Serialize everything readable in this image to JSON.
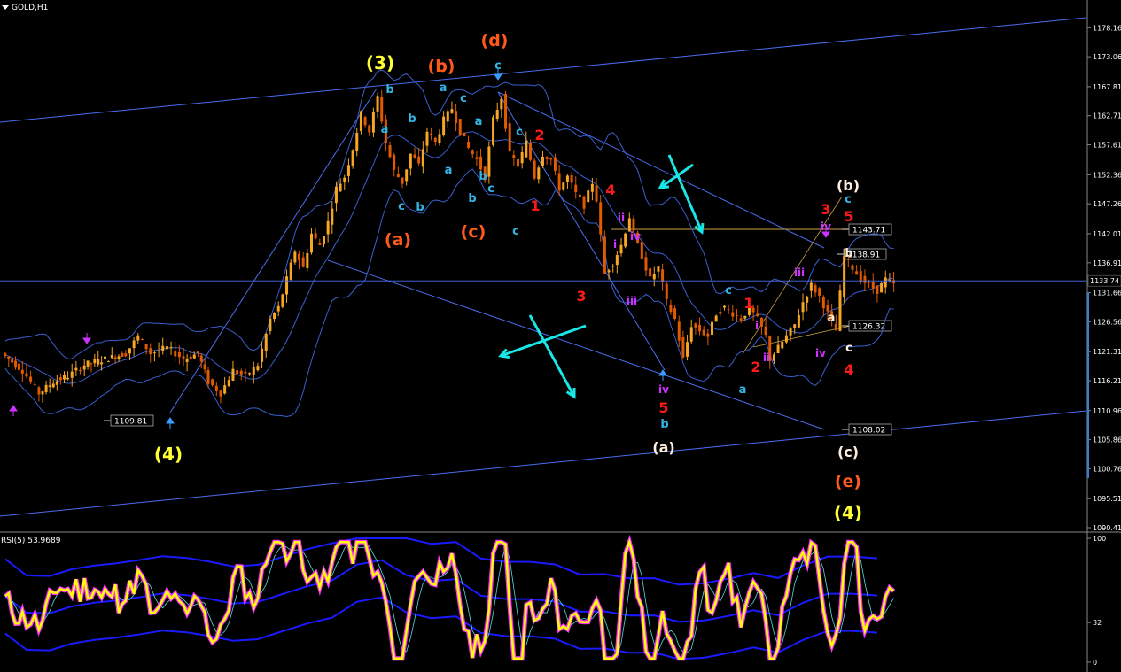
{
  "window": {
    "title": "GOLD,H1"
  },
  "rsi_panel": {
    "title": "RSI(5) 53.9689"
  },
  "colors": {
    "background": "#000000",
    "bull_candle": "#f5a623",
    "bear_candle": "#e05a00",
    "bollinger": "#3a5fcf",
    "channel": "#4a6df0",
    "wave_yellow": "#ffff33",
    "wave_orange": "#ff5a1a",
    "wave_cyan": "#33b5e5",
    "wave_red": "#ff1a1a",
    "wave_magenta": "#cc33ff",
    "wave_white": "#ffeedd",
    "cyan_arrows": "#19e6e6",
    "rsi_main": "#ffff00",
    "rsi_extreme": "#ff33ff",
    "rsi_bands": "#1a1aff"
  },
  "chart_data": [
    {
      "type": "candlestick",
      "title": "GOLD,H1",
      "ylim": [
        1090.41,
        1180.85
      ],
      "y_ticks": [
        "1178.16",
        "1173.06",
        "1167.81",
        "1162.71",
        "1157.61",
        "1152.36",
        "1147.26",
        "1142.01",
        "1136.91",
        "1131.66",
        "1126.56",
        "1121.31",
        "1116.21",
        "1110.96",
        "1105.86",
        "1100.76",
        "1095.51",
        "1090.41"
      ],
      "current_price": "1133.74",
      "price_boxes": [
        "1143.71",
        "1138.91",
        "1126.32",
        "1108.02",
        "1109.81"
      ],
      "close_path": [
        [
          0,
          1121
        ],
        [
          10,
          1118
        ],
        [
          18,
          1114
        ],
        [
          25,
          1116
        ],
        [
          32,
          1117
        ],
        [
          40,
          1119
        ],
        [
          50,
          1120
        ],
        [
          60,
          1121
        ],
        [
          66,
          1124
        ],
        [
          72,
          1121
        ],
        [
          80,
          1122
        ],
        [
          88,
          1120
        ],
        [
          95,
          1121
        ],
        [
          100,
          1116
        ],
        [
          106,
          1114
        ],
        [
          112,
          1118
        ],
        [
          118,
          1117
        ],
        [
          124,
          1119
        ],
        [
          130,
          1127
        ],
        [
          134,
          1129
        ],
        [
          138,
          1134
        ],
        [
          142,
          1139
        ],
        [
          146,
          1136
        ],
        [
          150,
          1142
        ],
        [
          154,
          1140
        ],
        [
          158,
          1144
        ],
        [
          162,
          1150
        ],
        [
          166,
          1152
        ],
        [
          170,
          1157
        ],
        [
          174,
          1163
        ],
        [
          178,
          1160
        ],
        [
          182,
          1166
        ],
        [
          186,
          1158
        ],
        [
          190,
          1153
        ],
        [
          194,
          1151
        ],
        [
          198,
          1156
        ],
        [
          202,
          1154
        ],
        [
          206,
          1160
        ],
        [
          210,
          1158
        ],
        [
          214,
          1162
        ],
        [
          218,
          1164
        ],
        [
          222,
          1160
        ],
        [
          226,
          1157
        ],
        [
          230,
          1155
        ],
        [
          234,
          1152
        ],
        [
          238,
          1162
        ],
        [
          242,
          1166
        ],
        [
          246,
          1156
        ],
        [
          250,
          1154
        ],
        [
          254,
          1158
        ],
        [
          258,
          1152
        ],
        [
          262,
          1156
        ],
        [
          266,
          1155
        ],
        [
          270,
          1150
        ],
        [
          274,
          1152
        ],
        [
          278,
          1149
        ],
        [
          282,
          1147
        ],
        [
          286,
          1151
        ],
        [
          288,
          1148
        ],
        [
          292,
          1135
        ],
        [
          296,
          1137
        ],
        [
          300,
          1140
        ],
        [
          304,
          1145
        ],
        [
          306,
          1142
        ],
        [
          310,
          1138
        ],
        [
          314,
          1134
        ],
        [
          318,
          1136
        ],
        [
          322,
          1130
        ],
        [
          326,
          1127
        ],
        [
          330,
          1120
        ],
        [
          334,
          1126
        ],
        [
          338,
          1125
        ],
        [
          342,
          1124
        ],
        [
          346,
          1128
        ],
        [
          350,
          1129
        ],
        [
          354,
          1128
        ],
        [
          358,
          1127
        ],
        [
          362,
          1129
        ],
        [
          366,
          1127
        ],
        [
          370,
          1124
        ],
        [
          372,
          1120
        ],
        [
          376,
          1122
        ],
        [
          380,
          1124
        ],
        [
          384,
          1126
        ],
        [
          388,
          1130
        ],
        [
          392,
          1133
        ],
        [
          396,
          1131
        ],
        [
          400,
          1128
        ],
        [
          404,
          1125
        ],
        [
          408,
          1138
        ],
        [
          412,
          1136
        ],
        [
          416,
          1134
        ],
        [
          420,
          1133
        ],
        [
          424,
          1132
        ],
        [
          428,
          1134
        ],
        [
          432,
          1133
        ]
      ],
      "rsi": {
        "title": "RSI(5)",
        "value": 53.9689,
        "ylim": [
          0,
          100
        ],
        "y_ticks": [
          "100",
          "32",
          "0"
        ]
      },
      "annotations": [
        {
          "label": "(3)",
          "color": "wave_yellow"
        },
        {
          "label": "(4)",
          "color": "wave_yellow"
        },
        {
          "label": "(4)",
          "color": "wave_yellow"
        },
        {
          "label": "(d)",
          "color": "wave_orange"
        },
        {
          "label": "(b)",
          "color": "wave_orange"
        },
        {
          "label": "(a)",
          "color": "wave_orange"
        },
        {
          "label": "(c)",
          "color": "wave_orange"
        },
        {
          "label": "(e)",
          "color": "wave_orange"
        },
        {
          "label": "(b)",
          "color": "wave_white"
        },
        {
          "label": "(a)",
          "color": "wave_white"
        },
        {
          "label": "(c)",
          "color": "wave_white"
        },
        {
          "label": "1",
          "color": "wave_red"
        },
        {
          "label": "2",
          "color": "wave_red"
        },
        {
          "label": "3",
          "color": "wave_red"
        },
        {
          "label": "4",
          "color": "wave_red"
        },
        {
          "label": "5",
          "color": "wave_red"
        },
        {
          "label": "1",
          "color": "wave_red"
        },
        {
          "label": "2",
          "color": "wave_red"
        },
        {
          "label": "3",
          "color": "wave_red"
        },
        {
          "label": "4",
          "color": "wave_red"
        },
        {
          "label": "5",
          "color": "wave_red"
        }
      ]
    }
  ],
  "labels": {
    "w3": "(3)",
    "w4a": "(4)",
    "w4b": "(4)",
    "od": "(d)",
    "ob": "(b)",
    "oa": "(a)",
    "oc": "(c)",
    "oe": "(e)",
    "wb": "(b)",
    "wa": "(a)",
    "wc": "(c)",
    "r1": "1",
    "r2": "2",
    "r3": "3",
    "r4": "4",
    "r5": "5",
    "r1b": "1",
    "r2b": "2",
    "r3b": "3",
    "r4b": "4",
    "r5b": "5",
    "cyan_letters": [
      "c",
      "b",
      "a",
      "c",
      "b",
      "a",
      "c",
      "b",
      "a",
      "b",
      "c",
      "b",
      "a",
      "c",
      "c",
      "b",
      "a",
      "c"
    ],
    "roman": [
      "ii",
      "iv",
      "i",
      "iii",
      "iv",
      "ii",
      "i",
      "iii",
      "iv",
      "iv"
    ],
    "white_small": [
      "a",
      "b",
      "c",
      "a",
      "b",
      "c"
    ]
  }
}
